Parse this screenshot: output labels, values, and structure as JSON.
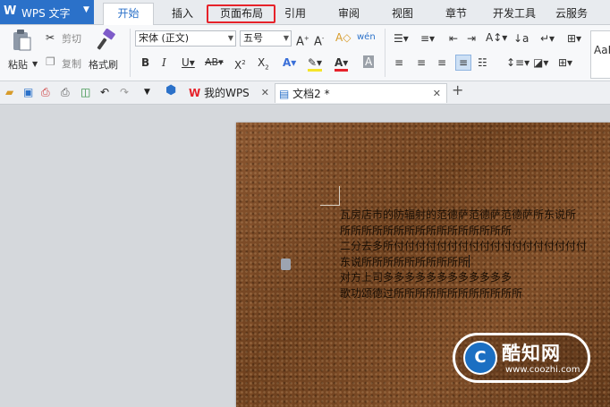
{
  "app": {
    "logo": "W",
    "title": "WPS 文字"
  },
  "menu_tabs": [
    {
      "label": "开始"
    },
    {
      "label": "插入"
    },
    {
      "label": "页面布局"
    },
    {
      "label": "引用"
    },
    {
      "label": "审阅"
    },
    {
      "label": "视图"
    },
    {
      "label": "章节"
    },
    {
      "label": "开发工具"
    },
    {
      "label": "云服务"
    }
  ],
  "ribbon": {
    "paste": "粘贴",
    "cut": "剪切",
    "copy": "复制",
    "format_painter": "格式刷",
    "font_name": "宋体 (正文)",
    "font_size": "五号",
    "style_preview": "AaB"
  },
  "doc_tabs": [
    {
      "label": "我的WPS"
    },
    {
      "label": "文档2 *"
    }
  ],
  "document": {
    "lines": [
      "瓦房店市的防辐射的范德萨范德萨范德萨所东说所",
      "所所所所所所所所所所所所所所所所",
      "二分去多所付付付付付付付付付付付付付付付付付付",
      "东说所所所所所所所所所所",
      "对方上司多多多多多多多多多多多多",
      "歌功颂德过所所所所所所所所所所所所"
    ]
  },
  "watermark": {
    "logo": "C",
    "name": "酷知网",
    "url": "www.coozhi.com"
  },
  "colors": {
    "accent": "#2b71c9",
    "highlight": "#e6222a",
    "page": "#7a4a24"
  }
}
